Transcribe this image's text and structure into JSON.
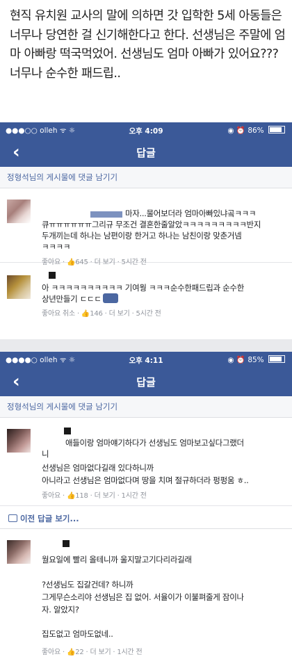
{
  "intro": {
    "text": "현직 유치원 교사의 말에 의하면 갓 입학한 5세 아동들은 너무나 당연한 걸 신기해한다고 한다. 선생님은 주말에 엄마 아빠랑 떡국먹었어. 선생님도 엄마 아빠가 있어요??? 너무나 순수한 패드립.."
  },
  "screen1": {
    "status": {
      "carrier": "●●●○○ olleh ᯤ ☼",
      "time": "오후 4:09",
      "icons": "◉ ⏰",
      "battery": "86%",
      "battery_level": 0.86
    },
    "nav": {
      "back": "‹",
      "title": "답글"
    },
    "post_link": "정형석님의 게시물에 댓글 남기기",
    "comments": [
      {
        "text": "마자...물어보더라 엄마아빠있냐곸ㅋㅋㅋ큐ㅠㅠㅠㅠㅠㅠ그리규 무조건 결혼한줄알았ㅋㅋㅋㅋㅋㅋㅋㅋㅋ반지두개끼는데 하나는 남편이랑 한거고 하나는 남친이랑 맞춘거넴ㅋㅋㅋㅋ",
        "line1": "마자...물어보더라 엄마아빠있냐곸ㅋㅋㅋ",
        "line2": "큐ㅠㅠㅠㅠㅠㅠ그리규 무조건 결혼한줄알았ㅋㅋㅋㅋㅋㅋㅋㅋㅋ반지",
        "line3": "두개끼는데 하나는 남편이랑 한거고 하나는 남친이랑 맞춘거넴",
        "line4": "ㅋㅋㅋㅋ",
        "meta_like": "좋아요 · ",
        "meta_count": "645",
        "meta_rest": " · 더 보기 · 5시간 전"
      },
      {
        "line1": "아 ㅋㅋㅋㅋㅋㅋㅋㅋㅋㅋ 기여웡 ㅋㅋㅋ순수한패드립과 순수한",
        "line2": "상년만들기 ㄷㄷㄷ",
        "meta_like": "좋아요 취소 · ",
        "meta_count": "146",
        "meta_rest": " · 더 보기 · 5시간 전"
      }
    ]
  },
  "screen2": {
    "status": {
      "carrier": "●●●●○ olleh ᯤ ☼",
      "time": "오후 4:11",
      "icons": "◉ ⏰",
      "battery": "85%",
      "battery_level": 0.85
    },
    "nav": {
      "back": "‹",
      "title": "답글"
    },
    "post_link": "정형석님의 게시물에 댓글 남기기",
    "comments": [
      {
        "line1": "애들이랑 엄마얘기하다가 선생님도 엄마보고싶다그랬더",
        "line2": "니",
        "line3": "선생님은 엄마없다길래 있다하니까",
        "line4": "아니라고 선생님은 엄마없다며 땅을 치며 절규하더라 펑펑움 ㅎ..",
        "meta_like": "좋아요 · ",
        "meta_count": "118",
        "meta_rest": " · 더 보기 · 1시간 전"
      },
      {
        "line1": "월요일에 빨리 올테니까 울지말고기다리라길래",
        "line2": "?선생님도 집갈건데? 하니까",
        "line3": "그게무슨소리야 선생님은 집 없어. 서율이가 이불펴줄게 잠이나",
        "line4": "자. 알았지?",
        "line5": "집도없고 엄마도없네..",
        "meta_like": "좋아요 · ",
        "meta_count": "22",
        "meta_rest": " · 더 보기 · 1시간 전"
      }
    ],
    "more_replies": "이전 답글 보기..."
  }
}
